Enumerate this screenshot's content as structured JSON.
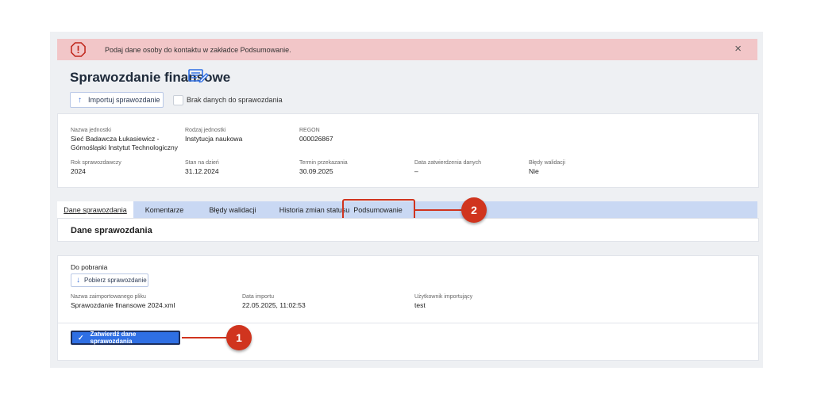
{
  "alert": {
    "message": "Podaj dane osoby do kontaktu w zakładce Podsumowanie.",
    "close_icon": "×"
  },
  "page": {
    "title": "Sprawozdanie finansowe",
    "title_icon": "edit-document-icon"
  },
  "toolbar": {
    "import_label": "Importuj sprawozdanie",
    "no_data_label": "Brak danych do sprawozdania"
  },
  "info": {
    "unit_name_label": "Nazwa jednostki",
    "unit_name_line1": "Sieć Badawcza Łukasiewicz -",
    "unit_name_line2": "Górnośląski Instytut Technologiczny",
    "unit_type_label": "Rodzaj jednostki",
    "unit_type": "Instytucja naukowa",
    "regon_label": "REGON",
    "regon": "000026867",
    "year_label": "Rok sprawozdawczy",
    "year": "2024",
    "as_of_label": "Stan na dzień",
    "as_of": "31.12.2024",
    "deadline_label": "Termin przekazania",
    "deadline": "30.09.2025",
    "approval_label": "Data zatwierdzenia danych",
    "approval": "–",
    "errors_label": "Błędy walidacji",
    "errors": "Nie"
  },
  "tabs": [
    {
      "label": "Dane sprawozdania"
    },
    {
      "label": "Komentarze"
    },
    {
      "label": "Błędy walidacji"
    },
    {
      "label": "Historia zmian statusu"
    },
    {
      "label": "Podsumowanie"
    }
  ],
  "section": {
    "title": "Dane sprawozdania"
  },
  "download": {
    "header": "Do pobrania",
    "get_label": "Pobierz sprawozdanie",
    "file_label": "Nazwa zaimportowanego pliku",
    "file": "Sprawozdanie finansowe 2024.xml",
    "import_date_label": "Data importu",
    "import_date": "22.05.2025, 11:02:53",
    "user_label": "Użytkownik importujący",
    "user": "test"
  },
  "actions": {
    "confirm_label": "Zatwierdź dane sprawozdania"
  },
  "callouts": [
    "1",
    "2"
  ],
  "colors": {
    "alert_bg": "#f2c6c8",
    "accent": "#2f6fe4",
    "tabs_bg": "#c9d8f3",
    "callout": "#d0341e"
  }
}
